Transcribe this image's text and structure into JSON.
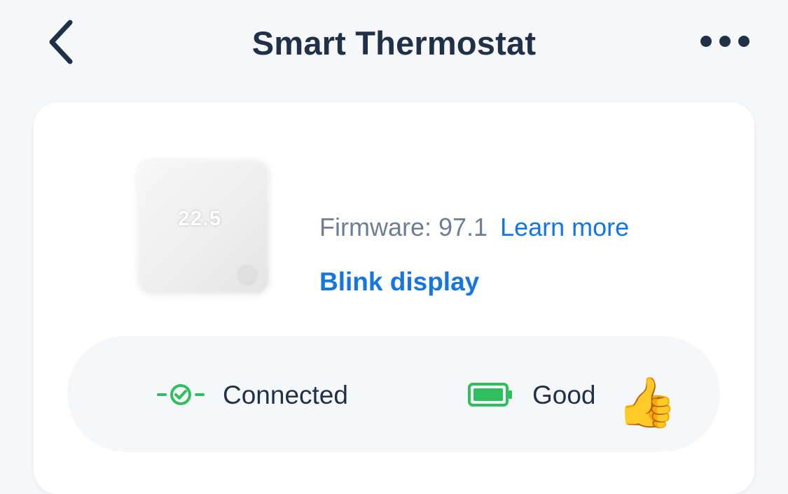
{
  "header": {
    "title": "Smart Thermostat",
    "back_icon": "chevron-left-icon",
    "more_icon": "more-horizontal-icon"
  },
  "device": {
    "display_reading": "22.5",
    "firmware_label": "Firmware: 97.1",
    "learn_more": "Learn more",
    "blink_display": "Blink display"
  },
  "status": {
    "connection": "Connected",
    "connection_icon": "connected-check-icon",
    "battery": "Good",
    "battery_icon": "battery-full-icon",
    "reaction_icon": "thumbs-up-icon",
    "reaction_glyph": "👍"
  },
  "colors": {
    "title": "#1f3047",
    "link": "#1676e0",
    "muted": "#6f7f91",
    "success": "#2fbf5e",
    "background": "#f5f7f9"
  }
}
